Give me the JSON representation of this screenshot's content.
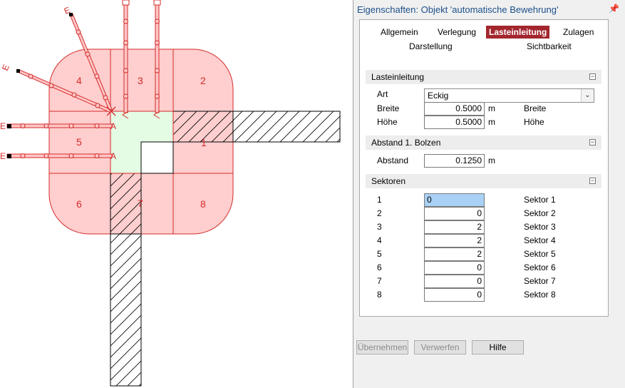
{
  "drawing": {
    "sector_labels": [
      "1",
      "2",
      "3",
      "4",
      "5",
      "6",
      "7",
      "8"
    ],
    "bar_end_label": "E",
    "anchor_label": "A"
  },
  "panel": {
    "title": "Eigenschaften: Objekt 'automatische Bewehrung'",
    "pin_icon": "pin-icon",
    "tabs": [
      {
        "label": "Allgemein",
        "active": false
      },
      {
        "label": "Verlegung",
        "active": false
      },
      {
        "label": "Lasteinleitung",
        "active": true
      },
      {
        "label": "Zulagen",
        "active": false
      },
      {
        "label": "Darstellung",
        "active": false
      },
      {
        "label": "Sichtbarkeit",
        "active": false
      }
    ],
    "groups": {
      "lasteinleitung": {
        "title": "Lasteinleitung",
        "art_label": "Art",
        "art_value": "Eckig",
        "breite_label": "Breite",
        "breite_value": "0.5000",
        "breite_unit": "m",
        "breite_right": "Breite",
        "hoehe_label": "Höhe",
        "hoehe_value": "0.5000",
        "hoehe_unit": "m",
        "hoehe_right": "Höhe"
      },
      "abstand": {
        "title": "Abstand 1. Bolzen",
        "label": "Abstand",
        "value": "0.1250",
        "unit": "m"
      },
      "sektoren": {
        "title": "Sektoren",
        "rows": [
          {
            "num": "1",
            "value": "0",
            "name": "Sektor 1"
          },
          {
            "num": "2",
            "value": "0",
            "name": "Sektor 2"
          },
          {
            "num": "3",
            "value": "2",
            "name": "Sektor 3"
          },
          {
            "num": "4",
            "value": "2",
            "name": "Sektor 4"
          },
          {
            "num": "5",
            "value": "2",
            "name": "Sektor 5"
          },
          {
            "num": "6",
            "value": "0",
            "name": "Sektor 6"
          },
          {
            "num": "7",
            "value": "0",
            "name": "Sektor 7"
          },
          {
            "num": "8",
            "value": "0",
            "name": "Sektor 8"
          }
        ]
      }
    },
    "buttons": {
      "apply": "Übernehmen",
      "discard": "Verwerfen",
      "help": "Hilfe"
    }
  }
}
